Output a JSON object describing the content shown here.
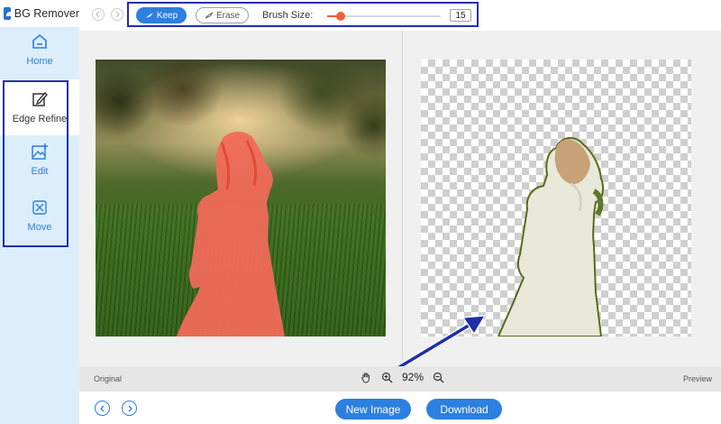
{
  "app": {
    "name": "BG Remover"
  },
  "sidebar": {
    "items": [
      {
        "label": "Home",
        "icon": "home-icon"
      },
      {
        "label": "Edge Refine",
        "icon": "edit-pencil-icon"
      },
      {
        "label": "Edit",
        "icon": "image-edit-icon"
      },
      {
        "label": "Move",
        "icon": "move-arrows-icon"
      }
    ]
  },
  "toolbar": {
    "keep_label": "Keep",
    "erase_label": "Erase",
    "brush_size_label": "Brush Size:",
    "brush_size_value": "15",
    "brush_slider_fraction": 0.12
  },
  "canvas": {
    "original_label": "Original",
    "preview_label": "Preview",
    "zoom_value": "92%"
  },
  "actions": {
    "new_image_label": "New Image",
    "download_label": "Download"
  },
  "colors": {
    "accent": "#2d7fe0",
    "highlight_outline": "#1d2fa8",
    "keep_mask": "#f06a5a",
    "slider": "#f0603a"
  }
}
